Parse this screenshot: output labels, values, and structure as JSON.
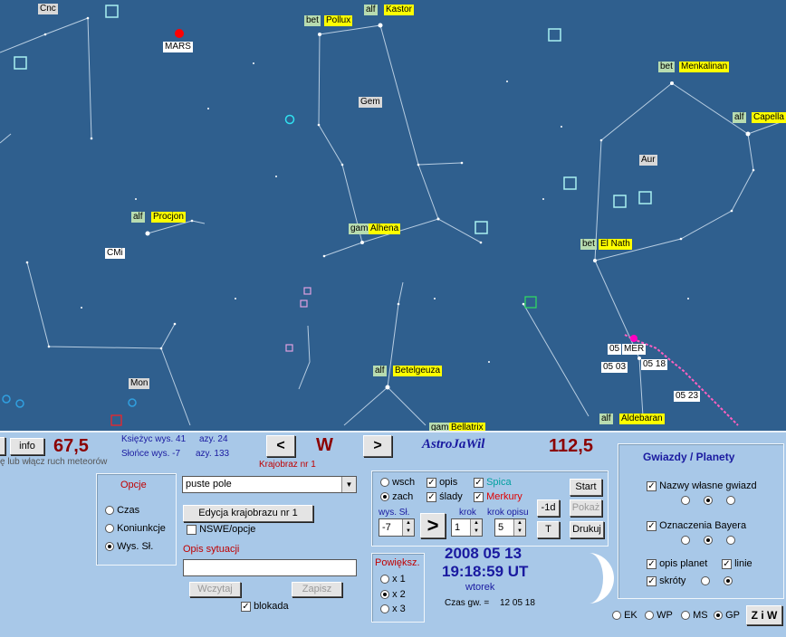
{
  "sky": {
    "planets": [
      {
        "label": "MARS",
        "color": "#ff0000"
      }
    ],
    "constellations": [
      "Cnc",
      "Gem",
      "Aur",
      "CMi",
      "Mon"
    ],
    "stars": [
      {
        "bayer": "bet",
        "name": "Pollux"
      },
      {
        "bayer": "alf",
        "name": "Kastor"
      },
      {
        "bayer": "bet",
        "name": "Menkalinan"
      },
      {
        "bayer": "alf",
        "name": "Capella"
      },
      {
        "bayer": "alf",
        "name": "Procjon"
      },
      {
        "bayer": "gam",
        "name": "Alhena"
      },
      {
        "bayer": "bet",
        "name": "El Nath"
      },
      {
        "bayer": "alf",
        "name": "Betelgeuza"
      },
      {
        "bayer": "gam",
        "name": "Bellatrix"
      },
      {
        "bayer": "alf",
        "name": "Aldebaran"
      }
    ],
    "track_labels": [
      "05",
      "MER",
      "05 03",
      "05 18",
      "05 23"
    ]
  },
  "panel": {
    "info_btn": "info",
    "left_value": "67,5",
    "hint": "ę lub włącz ruch meteorów",
    "moon_alt": "Księżyc wys. 41",
    "moon_az": "azy. 24",
    "sun_alt": "Słońce wys. -7",
    "sun_az": "azy. 133",
    "prev_btn": "<",
    "direction": "W",
    "next_btn": ">",
    "landscape": "Krajobraz nr 1",
    "app_title": "AstroJaWil",
    "right_value": "112,5",
    "options": {
      "title": "Opcje",
      "items": [
        "Czas",
        "Koniunkcje",
        "Wys. Sł."
      ],
      "selected": 2
    },
    "field_select": "puste pole",
    "edit_btn": "Edycja krajobrazu nr 1",
    "nswe": "NSWE/opcje",
    "desc_label": "Opis sytuacji",
    "load_btn": "Wczytaj",
    "save_btn": "Zapisz",
    "lock": "blokada",
    "controls": {
      "wsch": "wsch",
      "zach": "zach",
      "opis": "opis",
      "slady": "ślady",
      "spica": "Spica",
      "spica_color": "#00a0a0",
      "merkury": "Merkury",
      "merkury_color": "#e00000",
      "wys_sl": "wys. Sł.",
      "krok": "krok",
      "krok_opisu": "krok opisu",
      "wys_value": "-7",
      "krok_value": "1",
      "krok_opisu_value": "5",
      "go_btn": ">",
      "start_btn": "Start",
      "minus_btn": "-1d",
      "show_btn": "Pokaż",
      "t_btn": "T",
      "print_btn": "Drukuj"
    },
    "zoom": {
      "title": "Powiększ.",
      "items": [
        "x 1",
        "x 2",
        "x 3"
      ],
      "selected": 1
    },
    "date": "2008 05 13",
    "time": "19:18:59 UT",
    "weekday": "wtorek",
    "sidereal_label": "Czas gw. =",
    "sidereal_value": "12 05 18",
    "stars_panel": {
      "title": "Gwiazdy / Planety",
      "names": "Nazwy własne gwiazd",
      "bayer": "Oznaczenia Bayera",
      "planets": "opis planet",
      "lines": "linie",
      "abbr": "skróty"
    },
    "modes": [
      "EK",
      "WP",
      "MS",
      "GP"
    ],
    "mode_selected": 3,
    "ziw_btn": "Z i W"
  }
}
